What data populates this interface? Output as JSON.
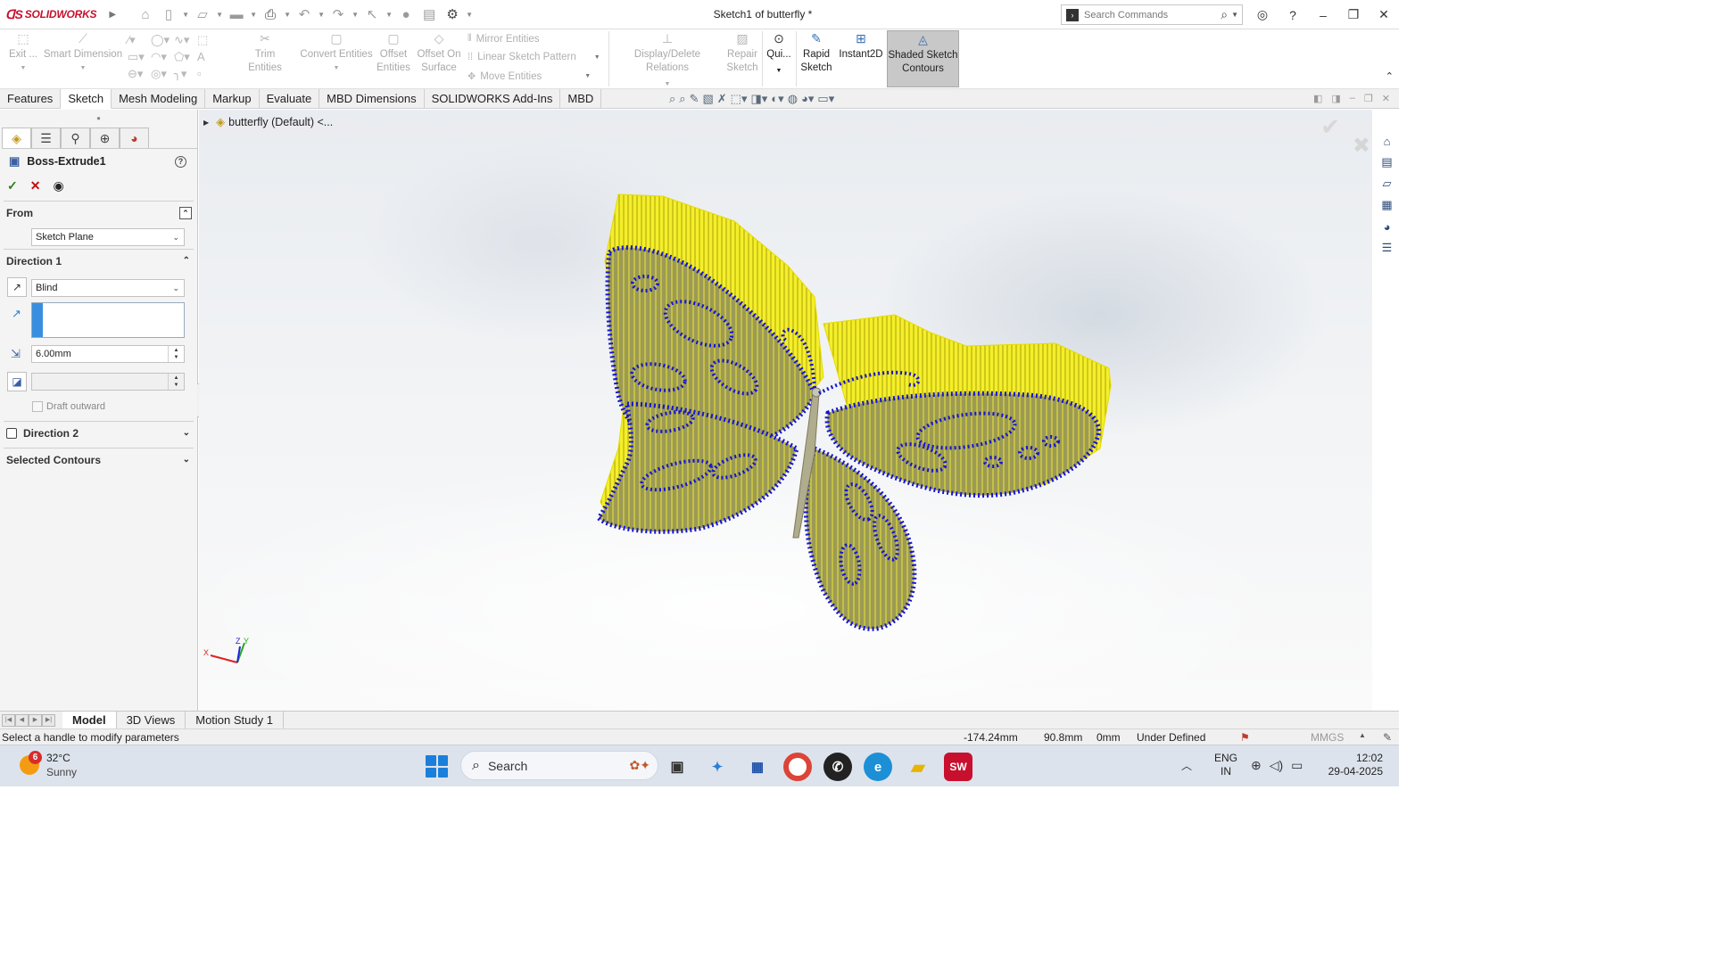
{
  "app": {
    "brand": "SOLIDWORKS",
    "document_title": "Sketch1 of butterfly *",
    "search_placeholder": "Search Commands"
  },
  "ribbon": {
    "exit_label": "Exit ...",
    "smart_dimension_label": "Smart Dimension",
    "trim_label": "Trim Entities",
    "convert_label": "Convert Entities",
    "offset_label": "Offset Entities",
    "offset_surface_label": "Offset On Surface",
    "mirror_label": "Mirror Entities",
    "linear_pattern_label": "Linear Sketch Pattern",
    "move_label": "Move Entities",
    "relations_label": "Display/Delete Relations",
    "repair_label": "Repair Sketch",
    "quick_snaps_label": "Qui...",
    "rapid_sketch_label": "Rapid Sketch",
    "instant2d_label": "Instant2D",
    "shaded_contours_label": "Shaded Sketch Contours"
  },
  "tabs": [
    "Features",
    "Sketch",
    "Mesh Modeling",
    "Markup",
    "Evaluate",
    "MBD Dimensions",
    "SOLIDWORKS Add-Ins",
    "MBD"
  ],
  "active_tab": "Sketch",
  "property_manager": {
    "title": "Boss-Extrude1",
    "from_label": "From",
    "from_value": "Sketch Plane",
    "direction1_label": "Direction 1",
    "end_condition": "Blind",
    "depth_value": "6.00mm",
    "draft_label": "Draft outward",
    "direction2_label": "Direction 2",
    "selected_contours_label": "Selected Contours"
  },
  "feature_tree": {
    "root_label": "butterfly (Default) <..."
  },
  "bottom_tabs": [
    "Model",
    "3D Views",
    "Motion Study 1"
  ],
  "active_bottom_tab": "Model",
  "status": {
    "message": "Select a handle to modify parameters",
    "x": "-174.24mm",
    "y": "90.8mm",
    "z": "0mm",
    "state": "Under Defined",
    "units": "MMGS"
  },
  "taskbar": {
    "temperature": "32°C",
    "condition": "Sunny",
    "weather_badge": "6",
    "search_placeholder": "Search",
    "lang_line1": "ENG",
    "lang_line2": "IN",
    "time": "12:02",
    "date": "29-04-2025"
  },
  "colors": {
    "extrude_yellow": "#f6f000",
    "sketch_blue": "#1414d2",
    "accent_red": "#c8102e"
  }
}
